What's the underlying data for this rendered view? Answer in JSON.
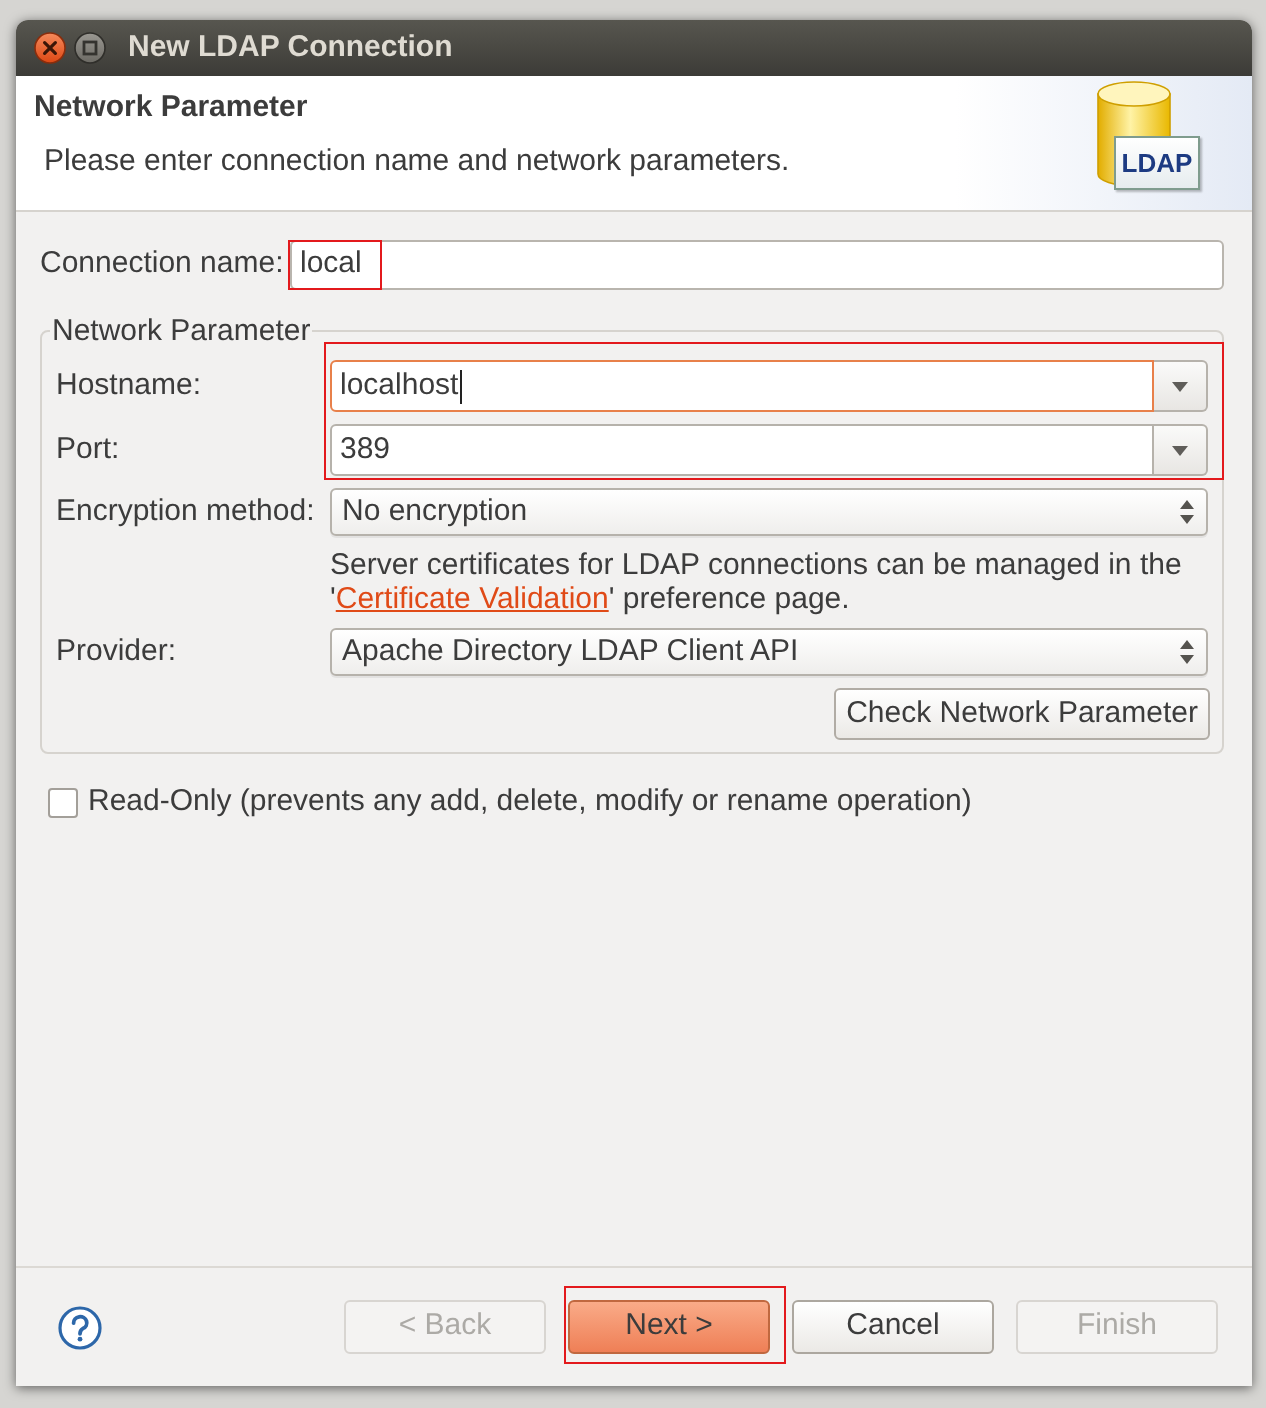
{
  "window": {
    "title": "New LDAP Connection"
  },
  "header": {
    "title": "Network Parameter",
    "description": "Please enter connection name and network parameters.",
    "logo_label": "LDAP"
  },
  "connection_name": {
    "label": "Connection name:",
    "value": "local",
    "highlighted": true
  },
  "network_parameter": {
    "legend": "Network Parameter",
    "rows": [
      {
        "kind": "combo",
        "label": "Hostname:",
        "value": "localhost",
        "focused": true,
        "highlighted": true
      },
      {
        "kind": "combo",
        "label": "Port:",
        "value": "389",
        "focused": false,
        "highlighted": true
      },
      {
        "kind": "select",
        "label": "Encryption method:",
        "value": "No encryption",
        "focused": false,
        "highlighted": false
      },
      {
        "kind": "note",
        "text_before": "Server certificates for LDAP connections can be managed in the '",
        "link": "Certificate Validation",
        "text_after": "' preference page."
      },
      {
        "kind": "select",
        "label": "Provider:",
        "value": "Apache Directory LDAP Client API",
        "focused": false,
        "highlighted": false
      }
    ],
    "button": "Check Network Parameter"
  },
  "read_only": {
    "label": "Read-Only (prevents any add, delete, modify or rename operation)",
    "checked": false
  },
  "buttons": [
    {
      "label": "< Back",
      "disabled": true,
      "default": false,
      "highlighted": false
    },
    {
      "label": "Next >",
      "disabled": false,
      "default": true,
      "highlighted": true
    },
    {
      "label": "Cancel",
      "disabled": false,
      "default": false,
      "highlighted": false
    },
    {
      "label": "Finish",
      "disabled": true,
      "default": false,
      "highlighted": false
    }
  ]
}
